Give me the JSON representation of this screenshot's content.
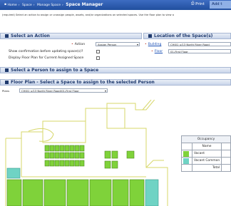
{
  "header": {
    "crumb_1": "Home",
    "crumb_2": "Space",
    "crumb_3": "Manage Space",
    "title": "Space Manager",
    "print_label": "Print",
    "add_label": "Add t"
  },
  "instructions": "(required) Select an action to assign or unassign people, assets, and/or organizations on selected spaces. Use the floor plan to view a",
  "action_section": {
    "title": "Select an Action",
    "action_label": "Action",
    "action_value": "Assign Person",
    "confirm_label": "Show confirmation before updating space(s)?",
    "display_label": "Display Floor Plan for Current Assigned Space"
  },
  "location_section": {
    "title": "Location of the Space(s)",
    "building_label": "Building",
    "building_value": "CHI01 u/13 North River Road",
    "floor_label": "Floor",
    "floor_value": "01-First Floor"
  },
  "person_section": {
    "title": "Select a Person to assign to a Space"
  },
  "floorplan_section": {
    "title": "Floor Plan - Select a Space to assign to the selected Person",
    "view_label": "Plans",
    "view_value": "CHI01 u/13 North River Road/01-First Floor"
  },
  "occupancy": {
    "title": "Occupancy",
    "col_name": "Name",
    "rows": [
      {
        "name": "Vacant",
        "color": "#7fd23a"
      },
      {
        "name": "Vacant Common",
        "color": "#6fd3c4"
      }
    ],
    "total_label": "Total"
  },
  "colors": {
    "header": "#2b5aad",
    "vacant": "#7fd23a",
    "vacant_common": "#6fd3c4",
    "outline": "#d7d76a"
  }
}
